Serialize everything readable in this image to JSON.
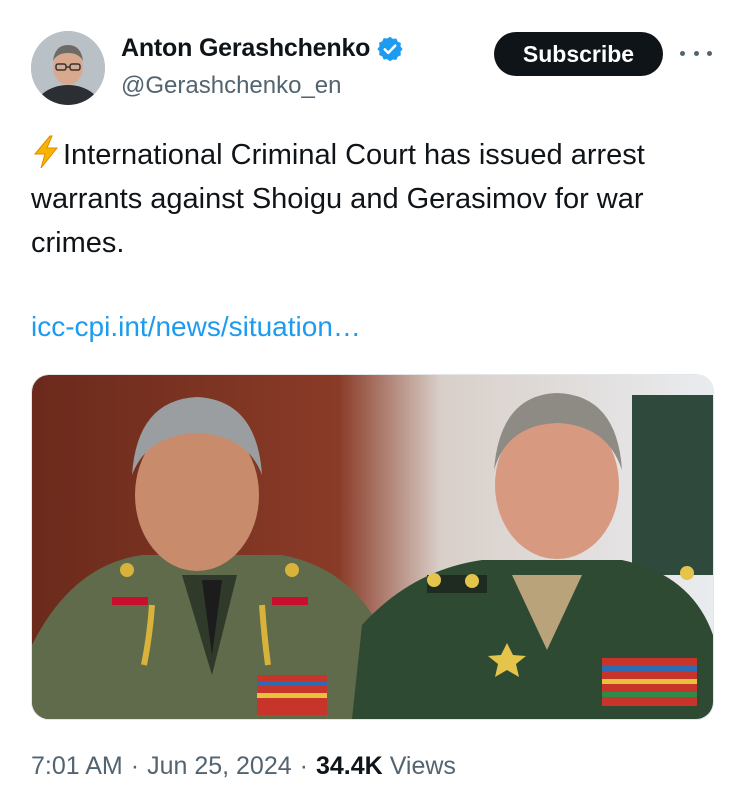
{
  "author": {
    "display_name": "Anton Gerashchenko",
    "handle": "@Gerashchenko_en",
    "verified_icon": "verified-badge-icon",
    "avatar": "profile-photo"
  },
  "header": {
    "subscribe_label": "Subscribe",
    "more_icon": "more-horizontal-icon"
  },
  "tweet": {
    "emoji": "high-voltage-emoji",
    "text": "International Criminal Court has issued arrest warrants against Shoigu and Gerasimov for war crimes.",
    "link_text": "icc-cpi.int/news/situation…",
    "media": "photo of two men in green military uniforms with medals"
  },
  "meta": {
    "time": "7:01 AM",
    "date": "Jun 25, 2024",
    "separator": "·",
    "views_count": "34.4K",
    "views_label": "Views"
  },
  "colors": {
    "link": "#1d9bf0",
    "verified": "#1d9bf0",
    "subscribe_bg": "#0f1419",
    "secondary_text": "#536471"
  }
}
